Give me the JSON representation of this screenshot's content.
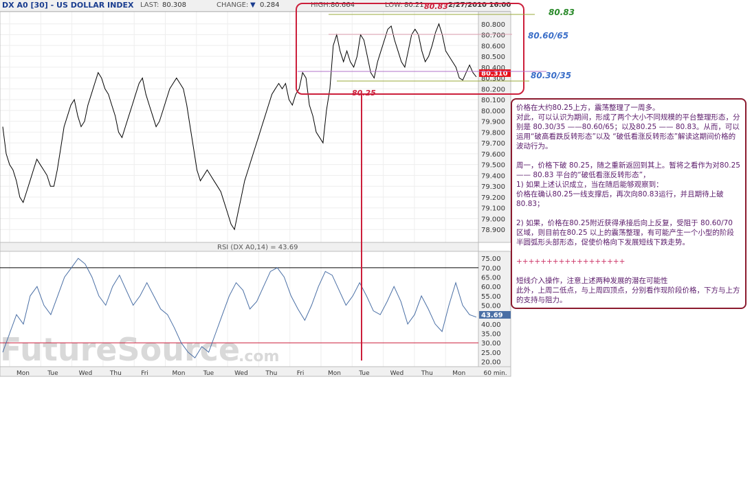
{
  "header": {
    "symbol": "DX A0 [30] - US DOLLAR INDEX",
    "last_label": "LAST:",
    "last_value": "80.308",
    "change_label": "CHANGE:",
    "change_value": "0.284",
    "high_label": "HIGH:",
    "high_value": "80.664",
    "low_label": "LOW:",
    "low_value": "80.21",
    "datetime": "2/27/2010 16:00"
  },
  "annotations": {
    "level_top": "80.83",
    "level_top_box": "80.83",
    "level_mid": "80.60/65",
    "level_low": "80.30/35",
    "level_bottom": "80.25",
    "last_tag": "80.310",
    "rsi_tag": "43.69",
    "watermark": "FutureSource",
    "watermark_suffix": ".com"
  },
  "chart_data": [
    {
      "type": "line",
      "title": "DX A0 [30] - US DOLLAR INDEX",
      "ylim": [
        78.8,
        80.9
      ],
      "y_ticks": [
        "80.800",
        "80.700",
        "80.600",
        "80.500",
        "80.400",
        "80.300",
        "80.200",
        "80.100",
        "80.000",
        "79.900",
        "79.800",
        "79.700",
        "79.600",
        "79.500",
        "79.400",
        "79.300",
        "79.200",
        "79.100",
        "79.000",
        "78.900"
      ],
      "x_tick_labels": [
        "Mon",
        "Tue",
        "Wed",
        "Thu",
        "Fri",
        "Mon",
        "Tue",
        "Wed",
        "Thu",
        "Fri",
        "Mon",
        "Tue",
        "Wed",
        "Thu",
        "Mon",
        "60 min."
      ],
      "series": [
        {
          "x": [
            0,
            1,
            2,
            3,
            4,
            5,
            6,
            7,
            8,
            9,
            10,
            11,
            12,
            13,
            14,
            15,
            16,
            17,
            18,
            19,
            20,
            21,
            22,
            23,
            24,
            25,
            26,
            27,
            28,
            29,
            30,
            31,
            32,
            33,
            34,
            35,
            36,
            37,
            38,
            39,
            40,
            41,
            42,
            43,
            44,
            45,
            46,
            47,
            48,
            49,
            50,
            51,
            52,
            53,
            54,
            55,
            56,
            57,
            58,
            59,
            60,
            61,
            62,
            63,
            64,
            65,
            66,
            67,
            68,
            69,
            70,
            71,
            72,
            73,
            74,
            75,
            76,
            77,
            78,
            79,
            80,
            81,
            82,
            83,
            84,
            85,
            86,
            87,
            88,
            89,
            90,
            91,
            92,
            93,
            94,
            95,
            96,
            97,
            98,
            99,
            100,
            101,
            102,
            103,
            104,
            105,
            106,
            107,
            108,
            109,
            110,
            111,
            112,
            113,
            114,
            115,
            116,
            117,
            118,
            119,
            120,
            121,
            122,
            123,
            124,
            125,
            126,
            127,
            128,
            129,
            130,
            131,
            132,
            133,
            134,
            135,
            136,
            137,
            138,
            139
          ],
          "values": [
            79.85,
            79.6,
            79.5,
            79.45,
            79.35,
            79.2,
            79.15,
            79.25,
            79.35,
            79.45,
            79.55,
            79.5,
            79.45,
            79.4,
            79.3,
            79.3,
            79.45,
            79.65,
            79.85,
            79.95,
            80.05,
            80.1,
            79.95,
            79.85,
            79.9,
            80.05,
            80.15,
            80.25,
            80.35,
            80.3,
            80.2,
            80.15,
            80.05,
            79.95,
            79.8,
            79.75,
            79.85,
            79.95,
            80.05,
            80.15,
            80.25,
            80.3,
            80.15,
            80.05,
            79.95,
            79.85,
            79.9,
            80.0,
            80.1,
            80.2,
            80.25,
            80.3,
            80.25,
            80.2,
            80.05,
            79.85,
            79.65,
            79.45,
            79.35,
            79.4,
            79.45,
            79.4,
            79.35,
            79.3,
            79.25,
            79.15,
            79.05,
            78.95,
            78.9,
            79.05,
            79.2,
            79.35,
            79.45,
            79.55,
            79.65,
            79.75,
            79.85,
            79.95,
            80.05,
            80.15,
            80.2,
            80.25,
            80.2,
            80.25,
            80.1,
            80.05,
            80.15,
            80.2,
            80.35,
            80.3,
            80.05,
            79.95,
            79.8,
            79.75,
            79.7,
            80.0,
            80.2,
            80.6,
            80.7,
            80.55,
            80.45,
            80.55,
            80.45,
            80.4,
            80.5,
            80.7,
            80.65,
            80.5,
            80.35,
            80.3,
            80.45,
            80.55,
            80.65,
            80.75,
            80.78,
            80.65,
            80.55,
            80.45,
            80.4,
            80.55,
            80.7,
            80.75,
            80.7,
            80.55,
            80.45,
            80.5,
            80.6,
            80.72,
            80.8,
            80.7,
            80.55,
            80.5,
            80.45,
            80.4,
            80.3,
            80.28,
            80.35,
            80.42,
            80.35,
            80.31
          ]
        }
      ]
    },
    {
      "type": "line",
      "title": "RSI (DX A0,14) = 43.69",
      "ylim": [
        18,
        78
      ],
      "y_ticks": [
        "75.00",
        "70.00",
        "65.00",
        "60.00",
        "55.00",
        "50.00",
        "45.00",
        "40.00",
        "35.00",
        "30.00",
        "25.00",
        "20.00"
      ],
      "reference_lines": [
        70,
        30
      ],
      "series": [
        {
          "x": [
            0,
            1,
            2,
            3,
            4,
            5,
            6,
            7,
            8,
            9,
            10,
            11,
            12,
            13,
            14,
            15,
            16,
            17,
            18,
            19,
            20,
            21,
            22,
            23,
            24,
            25,
            26,
            27,
            28,
            29,
            30,
            31,
            32,
            33,
            34,
            35,
            36,
            37,
            38,
            39,
            40,
            41,
            42,
            43,
            44,
            45,
            46,
            47,
            48,
            49,
            50,
            51,
            52,
            53,
            54,
            55,
            56,
            57,
            58,
            59,
            60,
            61,
            62,
            63,
            64,
            65,
            66,
            67,
            68,
            69
          ],
          "values": [
            25,
            35,
            45,
            40,
            55,
            60,
            50,
            45,
            55,
            65,
            70,
            75,
            72,
            65,
            55,
            50,
            60,
            66,
            58,
            50,
            55,
            62,
            55,
            48,
            45,
            38,
            30,
            25,
            22,
            28,
            25,
            35,
            45,
            55,
            62,
            58,
            48,
            52,
            60,
            68,
            70,
            65,
            55,
            48,
            42,
            50,
            60,
            68,
            66,
            58,
            50,
            55,
            62,
            55,
            47,
            45,
            52,
            60,
            52,
            40,
            45,
            55,
            48,
            40,
            36,
            50,
            62,
            50,
            45,
            43.69
          ]
        }
      ]
    }
  ],
  "notes": {
    "p1": "价格在大约80.25上方，震荡整理了一周多。",
    "p2": "对此，可以认识为期间，形成了两个大小不同规模的平台整理形态，分别是 80.30/35 ——80.60/65；以及80.25 —— 80.83。从而，可以运用“破高看跌反转形态”以及 “破低看涨反转形态”解读这期间价格的波动行为。",
    "p3": "周一，价格下破 80.25，随之重新返回到其上。暂将之看作为对80.25 —— 80.83 平台的“破低看涨反转形态”，",
    "p4": "1) 如果上述认识成立，当在随后能够观察到：",
    "p5": "价格在确认80.25一线支撑后，再次向80.83运行，并且期待上破80.83；",
    "p6": "2) 如果，价格在80.25附近获得承接后向上反复，受阻于 80.60/70 区域，则目前在80.25 以上的震荡整理，有可能产生一个小型的阶段半圆弧形头部形态，促使价格向下发展短线下跌走势。",
    "plus": "++++++++++++++++++",
    "p7": "短线介入操作，注意上述两种发展的潜在可能性",
    "p8": "此外，上周二低点，与上周四顶点，分别看作现阶段价格，下方与上方的支持与阻力。"
  },
  "colors": {
    "price_line": "#000000",
    "rsi_line": "#4a6fa5",
    "annotation_red": "#cc1e3a",
    "level_green": "#2a8a2a",
    "level_blue": "#3a6ec8",
    "guide_olive": "#9aa83a"
  }
}
